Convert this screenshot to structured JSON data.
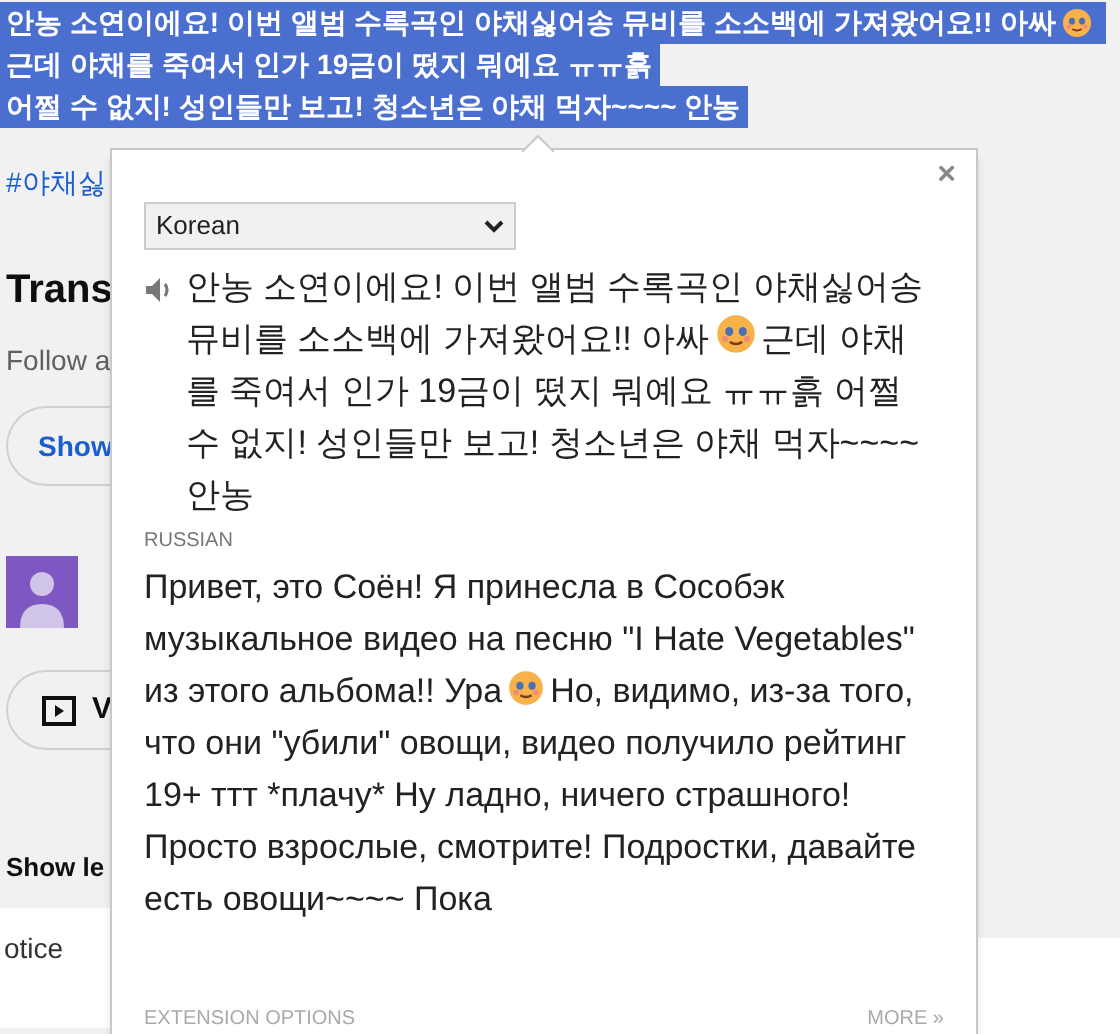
{
  "highlighted_lines": [
    {
      "text": "안농 소연이에요! 이번 앨범 수록곡인 야채싫어송 뮤비를 소소백에 가져왔어요!! 아싸",
      "emoji": true
    },
    {
      "text": "근데 야채를 죽여서 인가 19금이 떴지 뭐예요 ㅠㅠ흙",
      "emoji": false
    },
    {
      "text": "어쩔 수 없지! 성인들만 보고! 청소년은 야채 먹자~~~~ 안농",
      "emoji": false
    }
  ],
  "hashtag_link": "#야채싫",
  "section": {
    "title": "Trans",
    "subtitle": "Follow a",
    "button": "Show"
  },
  "video_button": {
    "label": "V"
  },
  "show_less": "Show le",
  "footer_text": "otice",
  "popup": {
    "close": "×",
    "language_select": "Korean",
    "source_text": {
      "before": "안농 소연이에요! 이번 앨범 수록곡인 야채싫어송 뮤비를 소소백에 가져왔어요!! 아싸",
      "after": "근데 야채를 죽여서 인가 19금이 떴지 뭐예요 ㅠㅠ흙 어쩔 수 없지! 성인들만 보고! 청소년은 야채 먹자~~~~ 안농"
    },
    "target_label": "RUSSIAN",
    "translation": {
      "before": "Привет, это Соён! Я принесла в Сособэк музыкальное видео на песню \"I Hate Vegetables\" из этого альбома!! Ура",
      "after": "Но, видимо, из-за того, что они \"убили\" овощи, видео получило рейтинг 19+ ттт *плачу* Ну ладно, ничего страшного! Просто взрослые, смотрите! Подростки, давайте есть овощи~~~~ Пока"
    },
    "options_link": "EXTENSION OPTIONS",
    "more_link": "MORE »"
  }
}
